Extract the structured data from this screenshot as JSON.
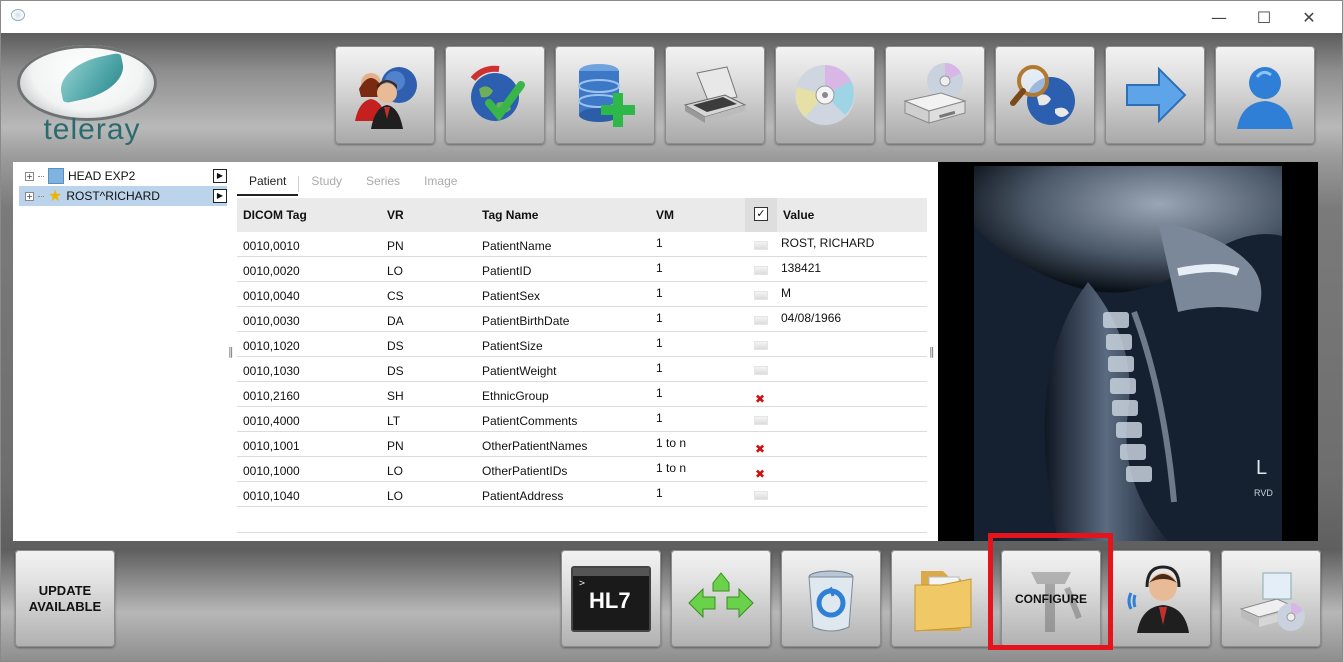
{
  "window": {
    "minimize": "—",
    "maximize": "☐",
    "close": "✕"
  },
  "logo": {
    "text": "teleray"
  },
  "toolbar": {
    "buttons": [
      {
        "icon": "patient-users-globe-icon"
      },
      {
        "icon": "network-globe-check-icon"
      },
      {
        "icon": "add-database-icon"
      },
      {
        "icon": "flatbed-scanner-icon"
      },
      {
        "icon": "cd-disc-icon"
      },
      {
        "icon": "disc-drive-icon"
      },
      {
        "icon": "search-globe-icon"
      },
      {
        "icon": "forward-arrow-icon"
      },
      {
        "icon": "user-profile-icon"
      }
    ]
  },
  "tree": {
    "items": [
      {
        "label": "HEAD EXP2",
        "expander": "+",
        "icon": "study-square-icon",
        "selected": false
      },
      {
        "label": "ROST^RICHARD",
        "expander": "+",
        "icon": "star-icon",
        "selected": true
      }
    ],
    "play_glyph": "▶"
  },
  "tabs": [
    {
      "label": "Patient",
      "active": true
    },
    {
      "label": "Study",
      "active": false
    },
    {
      "label": "Series",
      "active": false
    },
    {
      "label": "Image",
      "active": false
    }
  ],
  "grid": {
    "headers": {
      "tag": "DICOM Tag",
      "vr": "VR",
      "name": "Tag Name",
      "vm": "VM",
      "check": "✓",
      "value": "Value"
    },
    "rows": [
      {
        "tag": "0010,0010",
        "vr": "PN",
        "name": "PatientName",
        "vm": "1",
        "flag": "none",
        "value": "ROST, RICHARD"
      },
      {
        "tag": "0010,0020",
        "vr": "LO",
        "name": "PatientID",
        "vm": "1",
        "flag": "none",
        "value": "138421"
      },
      {
        "tag": "0010,0040",
        "vr": "CS",
        "name": "PatientSex",
        "vm": "1",
        "flag": "none",
        "value": "M"
      },
      {
        "tag": "0010,0030",
        "vr": "DA",
        "name": "PatientBirthDate",
        "vm": "1",
        "flag": "none",
        "value": "04/08/1966"
      },
      {
        "tag": "0010,1020",
        "vr": "DS",
        "name": "PatientSize",
        "vm": "1",
        "flag": "none",
        "value": ""
      },
      {
        "tag": "0010,1030",
        "vr": "DS",
        "name": "PatientWeight",
        "vm": "1",
        "flag": "none",
        "value": ""
      },
      {
        "tag": "0010,2160",
        "vr": "SH",
        "name": "EthnicGroup",
        "vm": "1",
        "flag": "x",
        "value": ""
      },
      {
        "tag": "0010,4000",
        "vr": "LT",
        "name": "PatientComments",
        "vm": "1",
        "flag": "none",
        "value": ""
      },
      {
        "tag": "0010,1001",
        "vr": "PN",
        "name": "OtherPatientNames",
        "vm": "1 to n",
        "flag": "x",
        "value": ""
      },
      {
        "tag": "0010,1000",
        "vr": "LO",
        "name": "OtherPatientIDs",
        "vm": "1 to n",
        "flag": "x",
        "value": ""
      },
      {
        "tag": "0010,1040",
        "vr": "LO",
        "name": "PatientAddress",
        "vm": "1",
        "flag": "none",
        "value": ""
      }
    ],
    "x_glyph": "✖"
  },
  "image_viewer": {
    "icon": "cervical-spine-xray-image",
    "markers": [
      "L",
      "RVD"
    ]
  },
  "bottom": {
    "update_label": "UPDATE\nAVAILABLE",
    "hl7_label": "HL7",
    "hl7_prompt": ">",
    "configure_label": "CONFIGURE",
    "icons": [
      "hl7-terminal-icon",
      "transfer-arrows-icon",
      "recycle-bin-icon",
      "folder-icon",
      "configure-tools-icon",
      "support-agent-icon",
      "burn-disc-icon"
    ]
  },
  "colors": {
    "highlight": "#e5131c",
    "selection": "#bcd3ec",
    "logo_teal": "#2b6b70"
  }
}
